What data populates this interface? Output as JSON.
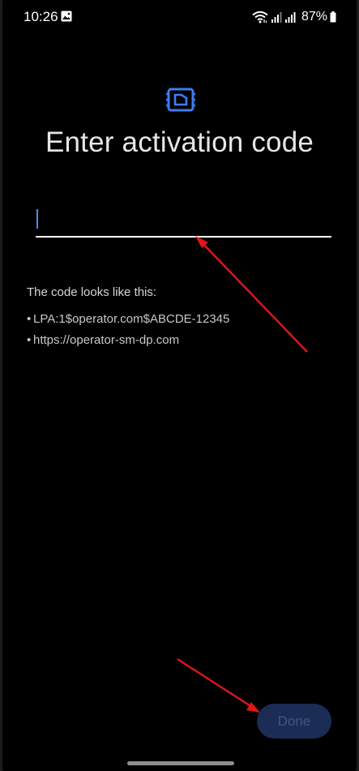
{
  "status_bar": {
    "time": "10:26",
    "battery": "87%"
  },
  "page": {
    "title": "Enter activation code"
  },
  "input": {
    "value": "",
    "placeholder": ""
  },
  "hint": {
    "heading": "The code looks like this:",
    "examples": [
      "LPA:1$operator.com$ABCDE-12345",
      "https://operator-sm-dp.com"
    ]
  },
  "actions": {
    "done_label": "Done"
  },
  "icons": {
    "header": "sim-card-icon",
    "status": [
      "image-icon",
      "wifi-icon",
      "signal-icon",
      "signal-icon",
      "battery-icon"
    ]
  },
  "colors": {
    "accent": "#3e7cf0",
    "done_bg": "#1b2d55",
    "done_text": "#3f5686",
    "annotation_arrow": "#e0161b"
  }
}
